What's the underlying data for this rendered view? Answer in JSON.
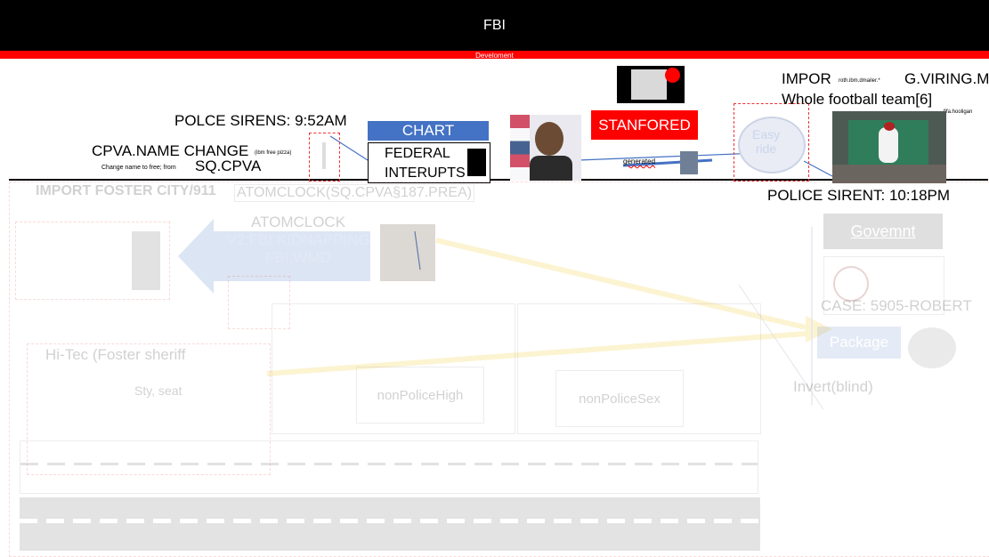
{
  "header": {
    "title": "FBI",
    "subtitle": "Develoment"
  },
  "labels": {
    "polce_sirens": "POLCE SIRENS: 9:52AM",
    "cpva_name_change": "CPVA.NAME CHANGE",
    "cpva_name_change_small": "(ibm free pizza)",
    "change_name_small": "Change name to free; from",
    "sq_cpva": "SQ.CPVA",
    "chart": "CHART",
    "federal_line1": "FEDERAL",
    "federal_line2": "INTERUPTS",
    "stanfored": "STANFORED",
    "generated_small": "generated",
    "impor": "IMPOR",
    "impor_small": "roth.ibm.dmailer.*",
    "g_viring": "G.VIRING.M",
    "whole_team": "Whole football team[6]",
    "fifa_small": "fifa.hooligan",
    "police_sirent": "POLICE SIRENT: 10:18PM",
    "easy_line1": "Easy",
    "easy_line2": "ride",
    "import_foster": "IMPORT FOSTER CITY/911",
    "atomclock_sq": "ATOMCLOCK(SQ.CPVA§187.PREA)",
    "atomclock": "ATOMCLOCK",
    "v2_kidnapping": "V2:FBI:KIDNAPPING",
    "fbi_wmd": "FBI:WMD",
    "govemnt": "Govemnt",
    "case": "CASE: 5905-ROBERT",
    "package": "Package",
    "invert": "Invert(blind)",
    "nonpolice_high": "nonPoliceHigh",
    "nonpolice_sex": "nonPoliceSex",
    "faded_heading": "Hi-Tec (Foster sheriff",
    "faded_small": "Sty, seat"
  }
}
